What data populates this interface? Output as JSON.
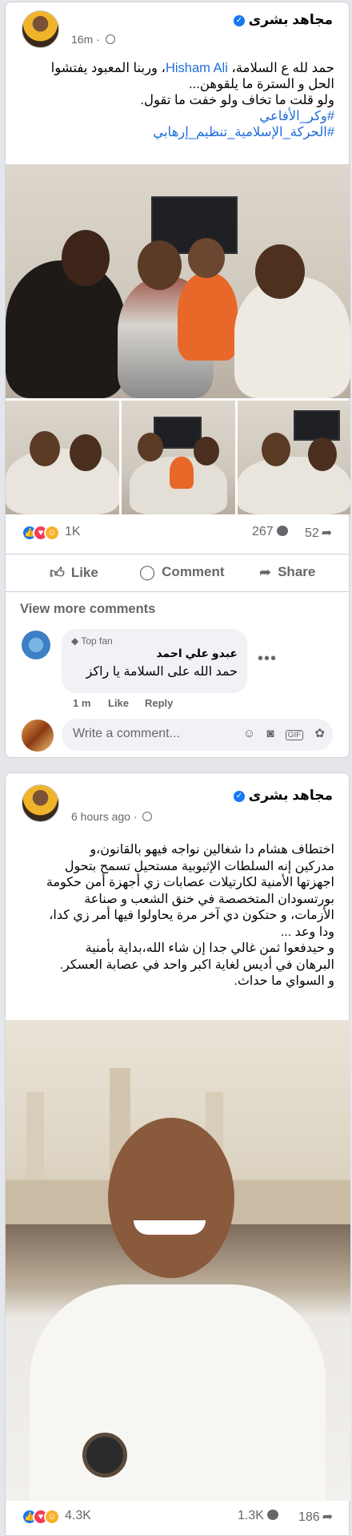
{
  "post1": {
    "author": "مجاهد بشرى",
    "time": "16m ·",
    "text_line1": "حمد لله ع السلامة، Hisham Ali، وربنا المعبود يفتشوا",
    "mention": "Hisham Ali",
    "text_line2": "الحل و السترة ما يلقوهن...",
    "text_line3": "ولو قلت ما تخاف ولو خفت ما تقول.",
    "hashtag1": "#وكر_الأفاعي",
    "hashtag2": "#الحركة_الإسلامية_تنظيم_إرهابي",
    "reaction_count": "1K",
    "comment_count": "267",
    "share_count": "52"
  },
  "actions": {
    "like": "Like",
    "comment": "Comment",
    "share": "Share"
  },
  "comments": {
    "view_more": "View more comments",
    "badge": "Top fan",
    "commenter": "عبدو علي احمد",
    "comment_text": "حمد الله على السلامة يا راكز",
    "comment_time": "1 m",
    "like": "Like",
    "reply": "Reply",
    "composer_placeholder": "Write a comment...",
    "gif_label": "GIF"
  },
  "post2": {
    "author": "مجاهد بشرى",
    "time": "6 hours ago ·",
    "lines": [
      "اختطاف هشام دا شغالين نواجه فيهو بالقانون،و",
      "مدركين إنه السلطات الإثيوبية مستحيل تسمح بتحول",
      "اجهزتها الأمنية لكارتيلات عصابات زي أجهزة أمن حكومة",
      "بورتسودان المتخصصة في خنق الشعب و صناعة",
      "الأزمات، و حتكون دي آخر مرة يحاولوا فيها أمر زي كدا،",
      "ودا وعد ...",
      "و حيدفعوا ثمن غالي جدا إن شاء الله،بداية بأمنية",
      "البرهان في أديس لغاية اكبر واحد في عصابة العسكر.",
      "و السواي ما حداث."
    ],
    "reaction_count": "4.3K",
    "comment_count": "1.3K",
    "share_count": "186"
  },
  "colors": {
    "like_blue": "#1877f2",
    "love_red": "#f33e58",
    "care_yellow": "#f7b125",
    "link_blue": "#216fdb",
    "muted_gray": "#65676b"
  }
}
